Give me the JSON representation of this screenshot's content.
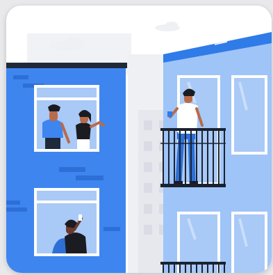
{
  "scene": {
    "subject": "apartment-buildings-with-residents",
    "colors": {
      "background": "#e9e9ec",
      "card": "#ffffff",
      "bg_buildings": "#f1f2f5",
      "bg_building_windows": "#e3e5ea",
      "left_building": "#3f85f0",
      "left_building_dark": "#2d6fd6",
      "roof_dark": "#1e2a3a",
      "right_building": "#9fc4f8",
      "right_roof": "#2f7be8",
      "window_frame": "#ffffff",
      "window_glass": "#a9c9f6",
      "railing": "#1a2230",
      "skin": "#b86b4b",
      "skin_dark": "#6b3a2a",
      "hair": "#1b1b22"
    }
  }
}
